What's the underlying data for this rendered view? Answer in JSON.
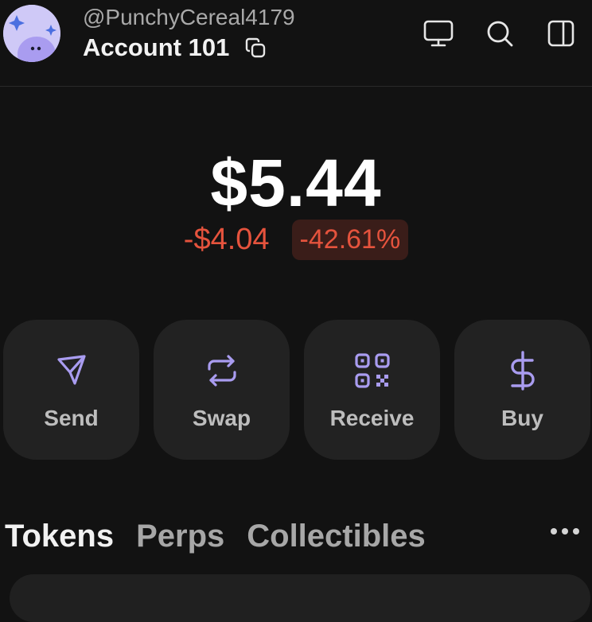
{
  "header": {
    "handle": "@PunchyCereal4179",
    "account_name": "Account 101",
    "icons": [
      "copy-icon",
      "monitor-icon",
      "search-icon",
      "sidebar-icon"
    ]
  },
  "balance": {
    "total": "$5.44",
    "change_amount": "-$4.04",
    "change_percent": "-42.61%"
  },
  "actions": [
    {
      "label": "Send",
      "icon": "send-icon"
    },
    {
      "label": "Swap",
      "icon": "swap-icon"
    },
    {
      "label": "Receive",
      "icon": "qr-code-icon"
    },
    {
      "label": "Buy",
      "icon": "dollar-icon"
    }
  ],
  "tabs": [
    {
      "label": "Tokens",
      "active": true
    },
    {
      "label": "Perps",
      "active": false
    },
    {
      "label": "Collectibles",
      "active": false
    }
  ],
  "colors": {
    "background": "#121212",
    "accent": "#a99cf0",
    "negative": "#e5533d",
    "card": "#222222"
  }
}
